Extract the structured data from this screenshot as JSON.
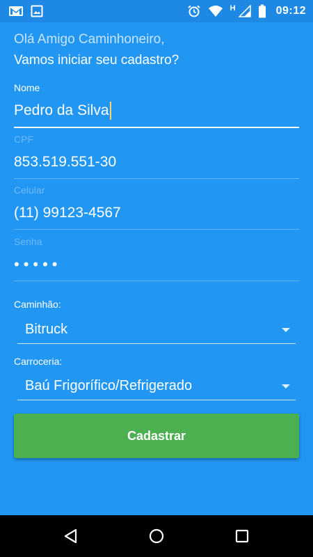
{
  "status_bar": {
    "time": "09:12",
    "network_type": "H",
    "left_icons": [
      "gmail-icon",
      "image-icon"
    ],
    "right_icons": [
      "alarm-icon",
      "wifi-icon",
      "signal-icon",
      "battery-icon"
    ]
  },
  "header": {
    "greeting": "Olá Amigo Caminhoneiro,",
    "subtitle": "Vamos iniciar seu cadastro?"
  },
  "form": {
    "name": {
      "label": "Nome",
      "value": "Pedro da Silva"
    },
    "cpf": {
      "label": "CPF",
      "value": "853.519.551-30"
    },
    "phone": {
      "label": "Celular",
      "value": "(11) 99123-4567"
    },
    "password": {
      "label": "Senha",
      "value": "•••••"
    },
    "truck": {
      "label": "Caminhão:",
      "selected": "Bitruck"
    },
    "body_type": {
      "label": "Carroceria:",
      "selected": "Baú Frigorífico/Refrigerado"
    },
    "submit_label": "Cadastrar"
  },
  "colors": {
    "background": "#2196f3",
    "status_bar": "#1e88e5",
    "button": "#4caf50",
    "nav_bar": "#000000",
    "cursor": "#ffd36b"
  },
  "nav": {
    "buttons": [
      "back-icon",
      "home-icon",
      "recents-icon"
    ]
  }
}
